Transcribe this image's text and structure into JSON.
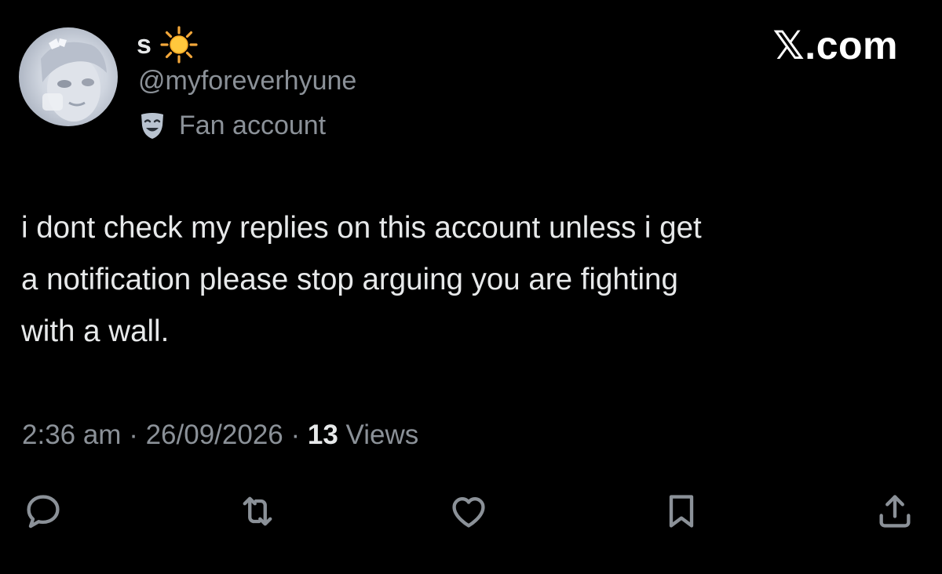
{
  "author": {
    "display_name": "s",
    "name_emoji": "sun-icon",
    "handle": "@myforeverhyune",
    "affiliation_icon": "theater-mask-icon",
    "affiliation_label": "Fan account"
  },
  "brand": "𝕏.com",
  "tweet": {
    "text": "i dont check my replies on this account unless i get\na notification please stop arguing you are fighting\nwith a wall."
  },
  "meta": {
    "time": "2:36 am",
    "separator1": " · ",
    "date": "26/09/2026",
    "separator2": " · ",
    "views_count": "13",
    "views_label": " Views"
  },
  "actions": [
    {
      "name": "reply",
      "icon": "reply-icon"
    },
    {
      "name": "repost",
      "icon": "repost-icon"
    },
    {
      "name": "like",
      "icon": "heart-icon"
    },
    {
      "name": "bookmark",
      "icon": "bookmark-icon"
    },
    {
      "name": "share",
      "icon": "share-icon"
    }
  ],
  "colors": {
    "background": "#000000",
    "primary_text": "#e7e9ea",
    "secondary_text": "#8b9198",
    "icon": "#8b9198"
  }
}
